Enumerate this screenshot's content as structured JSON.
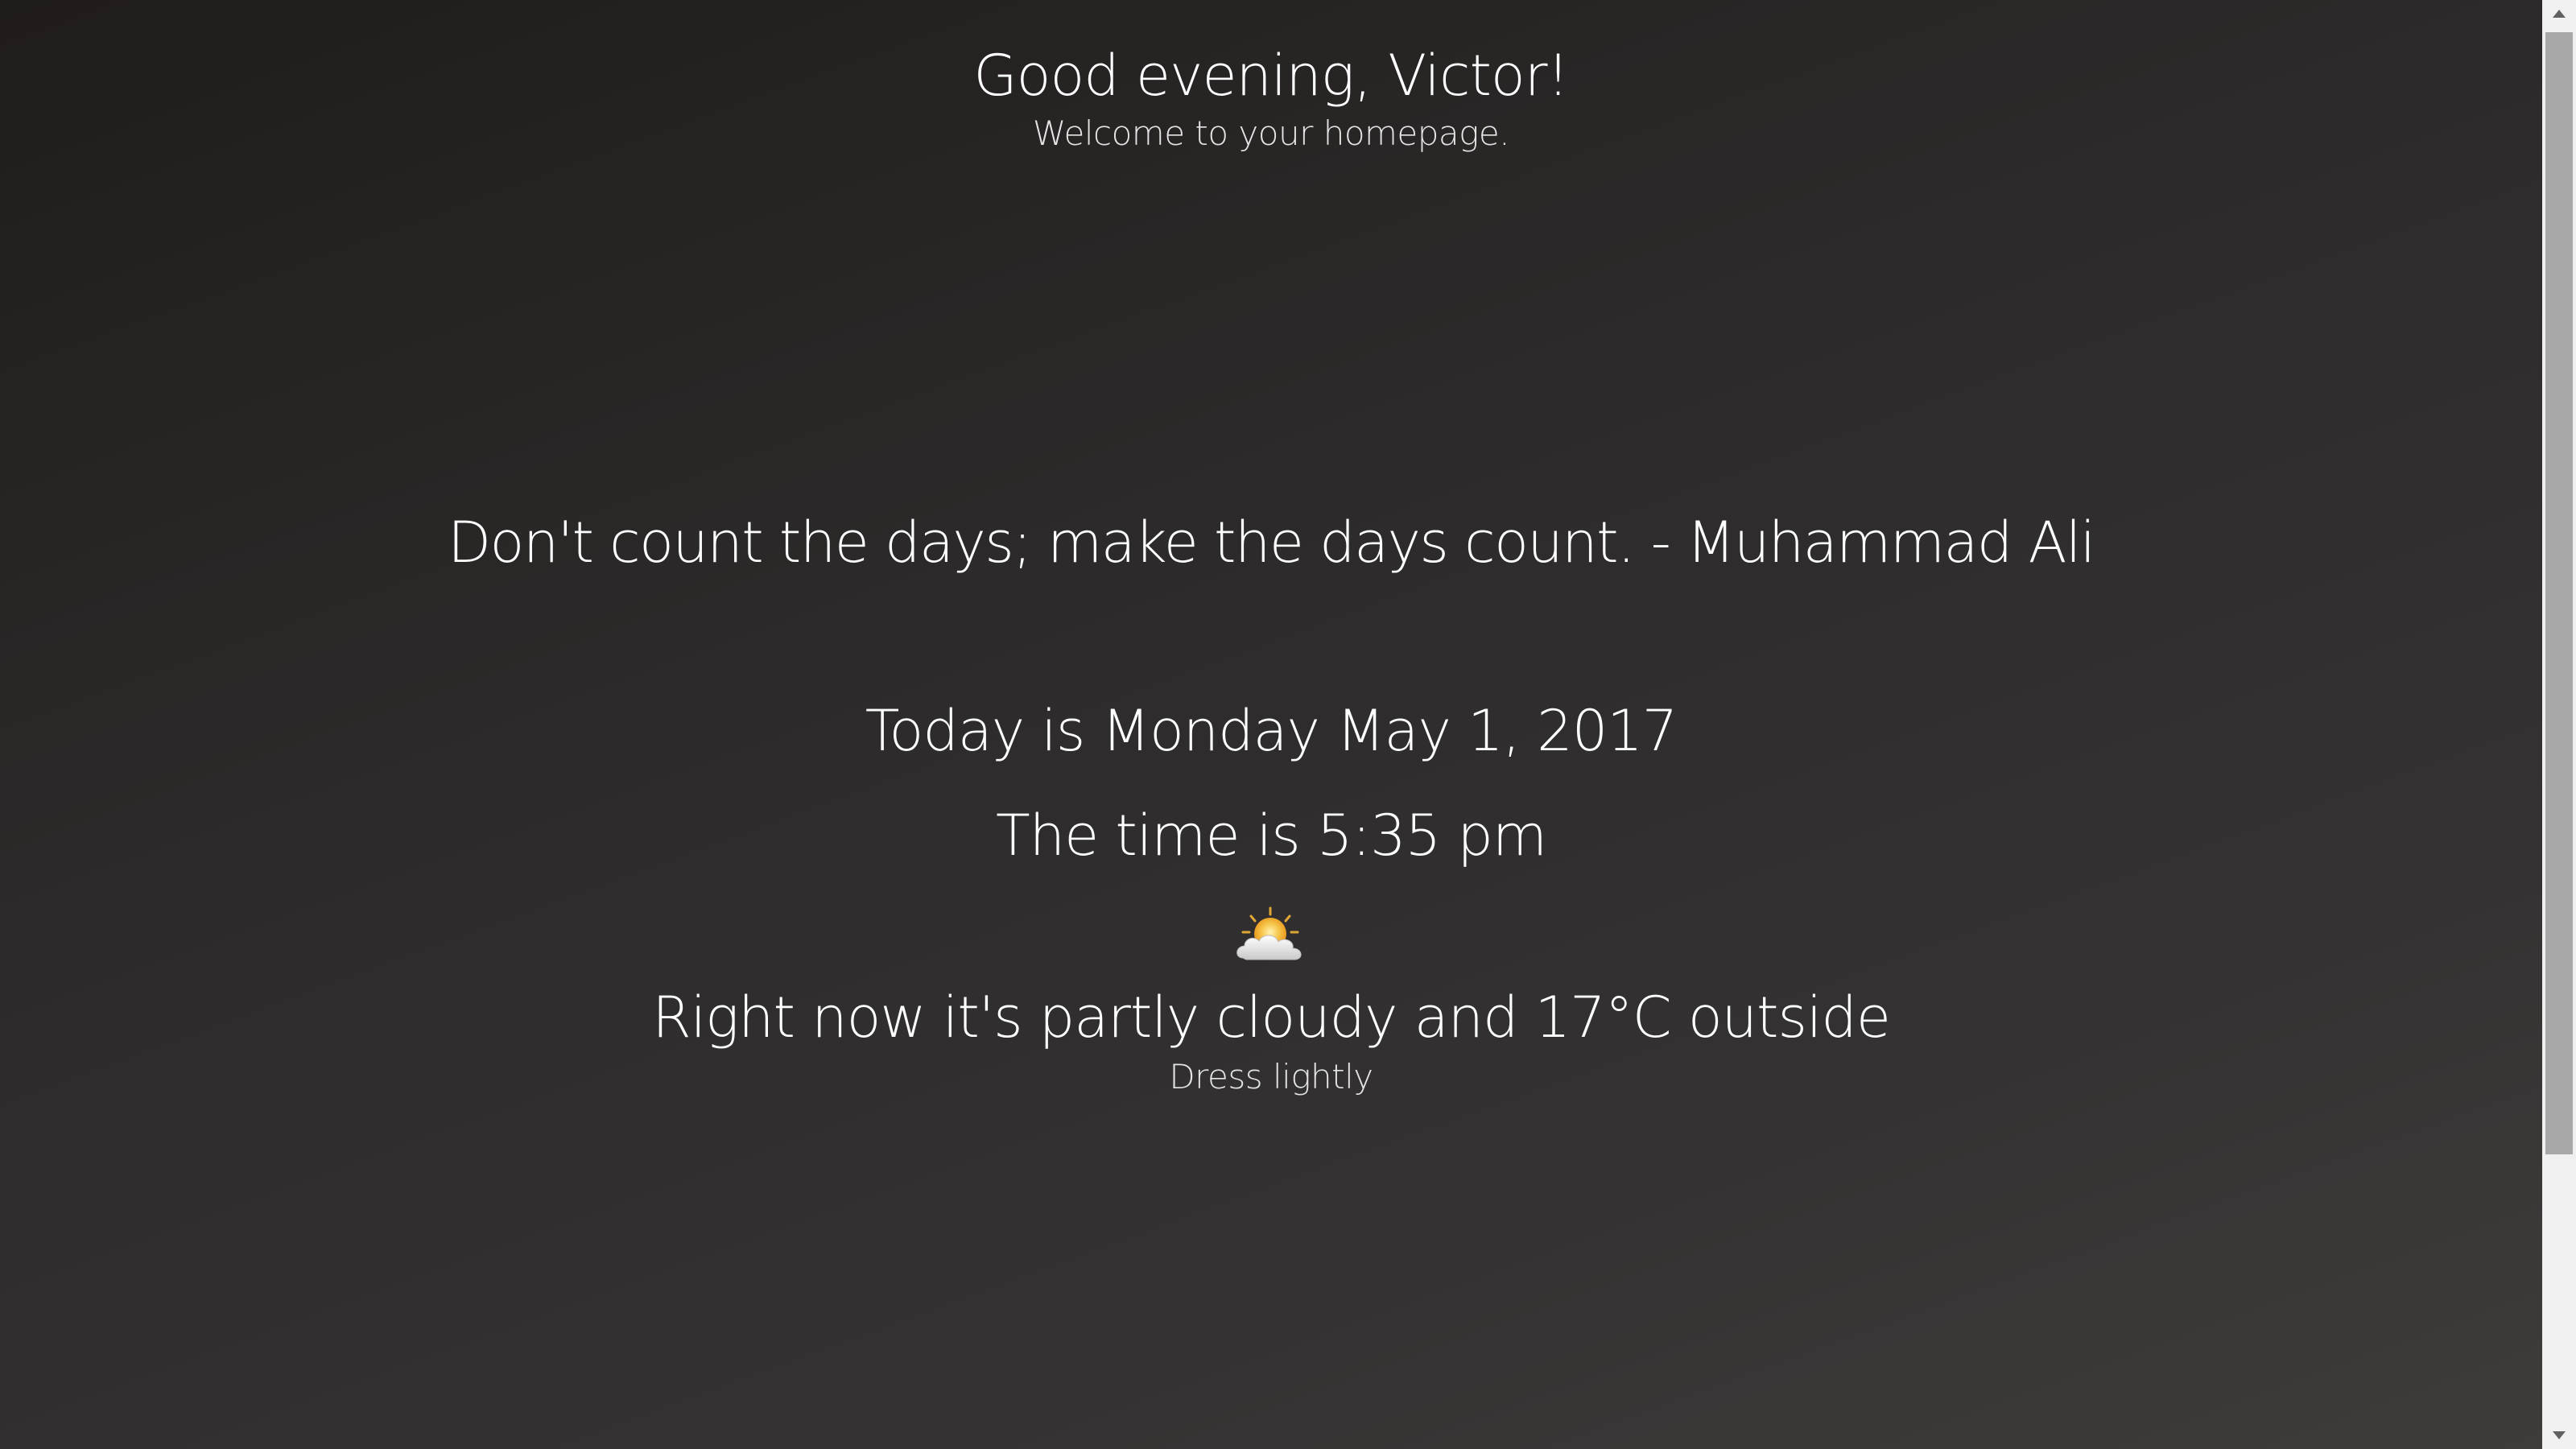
{
  "greeting": {
    "title": "Good evening, Victor!",
    "subtitle": "Welcome to your homepage."
  },
  "quote": {
    "text": "Don't count the days; make the days count. - Muhammad Ali"
  },
  "datetime": {
    "date_text": "Today is Monday May 1, 2017",
    "time_text": "The time is 5:35 pm"
  },
  "weather": {
    "icon": "partly-cloudy-icon",
    "summary": "Right now it's partly cloudy and 17°C outside",
    "advice": "Dress lightly"
  },
  "colors": {
    "background_start": "#211c1c",
    "background_end": "#3f3b3b",
    "text": "#ffffff",
    "sun": "#f4b53a",
    "cloud": "#e9e9e9"
  }
}
